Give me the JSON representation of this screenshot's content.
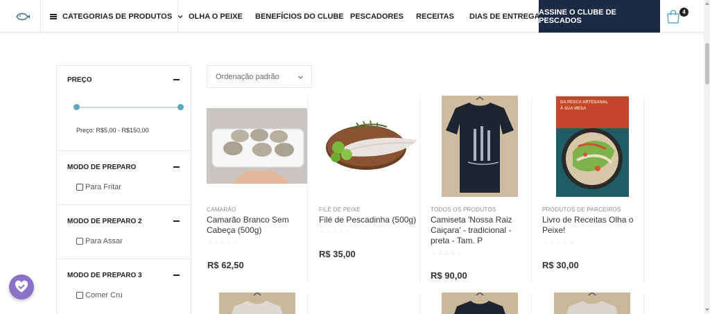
{
  "header": {
    "logo_icon": "fish-logo-icon",
    "categories_label": "CATEGORIAS DE PRODUTOS",
    "nav": [
      "OLHA O PEIXE",
      "BENEFÍCIOS DO CLUBE",
      "PESCADORES",
      "RECEITAS",
      "DIAS DE ENTREGA"
    ],
    "cta_label": "ASSINE O CLUBE DE PESCADOS",
    "cart_count": "4",
    "cta_color": "#1c2b45"
  },
  "filters": {
    "price": {
      "title": "PREÇO",
      "range_text": "Preço: R$5,00 - R$150,00",
      "accent_color": "#5da8bf"
    },
    "groups": [
      {
        "title": "MODO DE PREPARO",
        "option": "Para Fritar"
      },
      {
        "title": "MODO DE PREPARO 2",
        "option": "Para Assar"
      },
      {
        "title": "MODO DE PREPARO 3",
        "option": "Comer Cru"
      }
    ]
  },
  "sort": {
    "selected": "Ordenação padrão"
  },
  "products": [
    {
      "category": "CAMARÃO",
      "name_lines": [
        "Camarão Branco Sem",
        "Cabeça (500g)"
      ],
      "rating": "☆☆☆☆☆",
      "price": "R$ 62,50"
    },
    {
      "category": "FILÉ DE PEIXE",
      "name_lines": [
        "Filé de Pescadinha (500g)"
      ],
      "rating": "☆☆☆☆☆",
      "price": "R$ 35,00"
    },
    {
      "category": "TODOS OS PRODUTOS",
      "name_lines": [
        "Camiseta 'Nossa Raiz",
        "Caiçara' - tradicional -",
        "preta - Tam. P"
      ],
      "rating": "☆☆☆☆☆",
      "price": "R$ 90,00"
    },
    {
      "category": "PRODUTOS DE PARCEIROS",
      "name_lines": [
        "Livro de Receitas Olha o",
        "Peixe!"
      ],
      "rating": "☆☆☆☆☆",
      "price": "R$ 30,00"
    }
  ],
  "book_cover": {
    "top_lines": [
      "DA PESCA ARTESANAL",
      "À SUA MESA"
    ]
  }
}
